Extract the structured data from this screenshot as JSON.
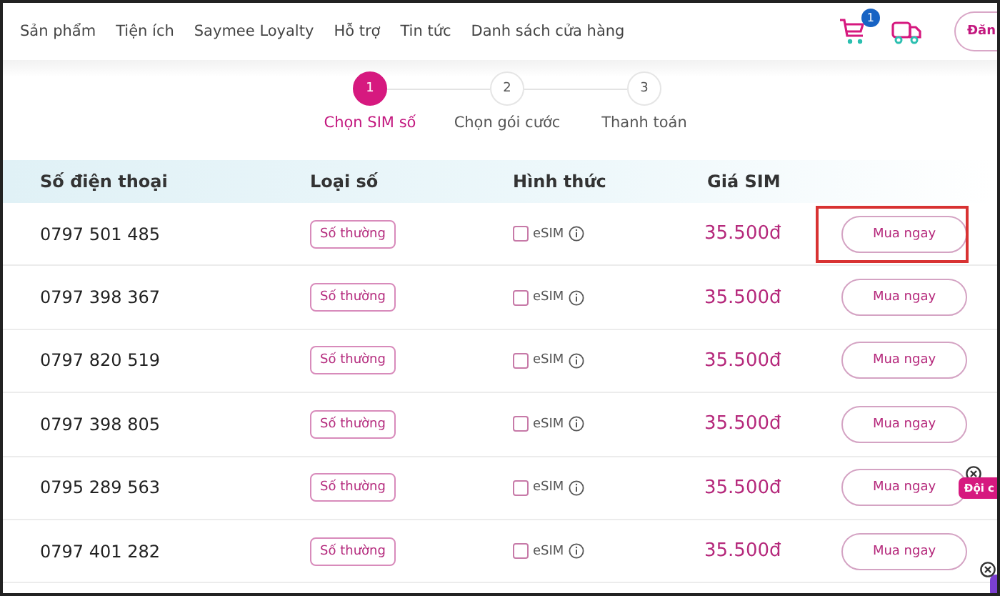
{
  "nav": {
    "items": [
      "Sản phẩm",
      "Tiện ích",
      "Saymee Loyalty",
      "Hỗ trợ",
      "Tin tức",
      "Danh sách cửa hàng"
    ],
    "cart_count": "1",
    "login_button": "Đăn"
  },
  "steps": [
    {
      "number": "1",
      "label": "Chọn SIM số",
      "selected": true
    },
    {
      "number": "2",
      "label": "Chọn gói cước",
      "selected": false
    },
    {
      "number": "3",
      "label": "Thanh toán",
      "selected": false
    }
  ],
  "table": {
    "columns": [
      "Số điện thoại",
      "Loại số",
      "Hình thức",
      "Giá SIM"
    ],
    "rows": [
      {
        "phone": "0797 501 485",
        "type": "Số thường",
        "esim_label": "eSIM",
        "esim_checked": false,
        "price": "35.500đ",
        "button": "Mua ngay",
        "highlighted": true
      },
      {
        "phone": "0797 398 367",
        "type": "Số thường",
        "esim_label": "eSIM",
        "esim_checked": false,
        "price": "35.500đ",
        "button": "Mua ngay",
        "highlighted": false
      },
      {
        "phone": "0797 820 519",
        "type": "Số thường",
        "esim_label": "eSIM",
        "esim_checked": false,
        "price": "35.500đ",
        "button": "Mua ngay",
        "highlighted": false
      },
      {
        "phone": "0797 398 805",
        "type": "Số thường",
        "esim_label": "eSIM",
        "esim_checked": false,
        "price": "35.500đ",
        "button": "Mua ngay",
        "highlighted": false
      },
      {
        "phone": "0795 289 563",
        "type": "Số thường",
        "esim_label": "eSIM",
        "esim_checked": false,
        "price": "35.500đ",
        "button": "Mua ngay",
        "highlighted": false
      },
      {
        "phone": "0797 401 282",
        "type": "Số thường",
        "esim_label": "eSIM",
        "esim_checked": false,
        "price": "35.500đ",
        "button": "Mua ngay",
        "highlighted": false
      }
    ]
  },
  "floating_tag": "Đội c"
}
